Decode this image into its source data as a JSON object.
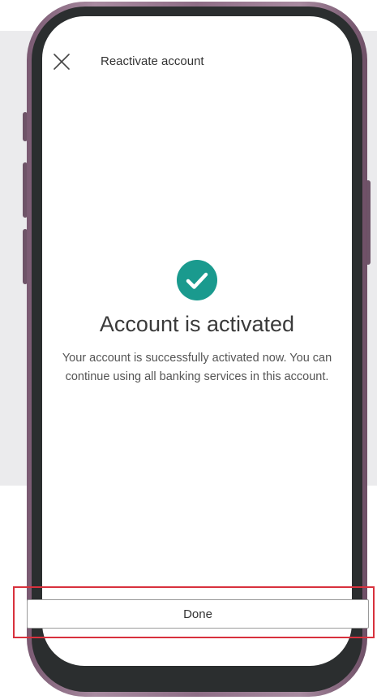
{
  "header": {
    "title": "Reactivate account",
    "close_icon": "close-icon"
  },
  "status": {
    "icon": "check-circle-icon",
    "icon_color": "#1a9a8e",
    "title": "Account is activated",
    "message": "Your account is successfully activated now. You can continue using all banking services in this account."
  },
  "actions": {
    "done_label": "Done"
  },
  "colors": {
    "highlight": "#d8313d",
    "phone_frame": "#8e6d86"
  }
}
